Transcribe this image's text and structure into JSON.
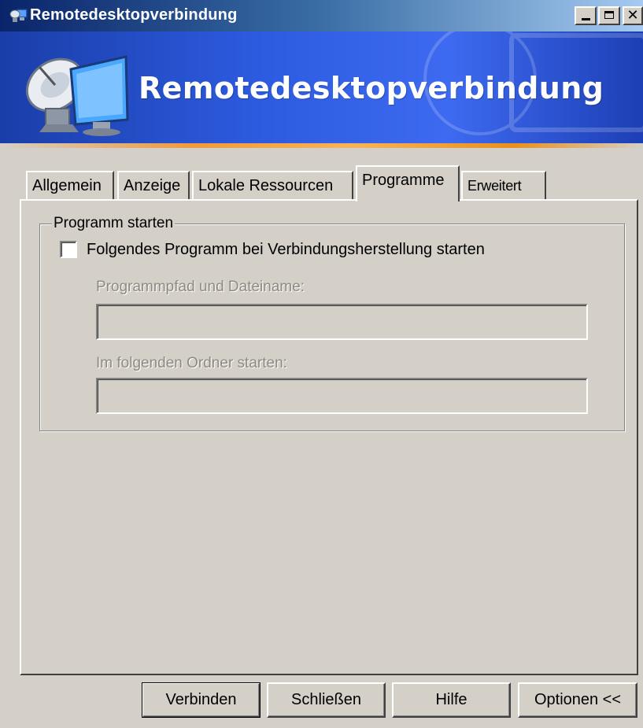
{
  "window": {
    "title": "Remotedesktopverbindung",
    "icon": "remote-desktop-icon",
    "controls": [
      "minimize-icon",
      "maximize-icon",
      "close-icon"
    ]
  },
  "banner": {
    "title": "Remotedesktopverbindung",
    "icon": "remote-desktop-satellite-monitor-icon"
  },
  "tabs": [
    {
      "label": "Allgemein",
      "active": false
    },
    {
      "label": "Anzeige",
      "active": false
    },
    {
      "label": "Lokale Ressourcen",
      "active": false
    },
    {
      "label": "Programme",
      "active": true
    },
    {
      "label": "Erweitert",
      "active": false
    }
  ],
  "group": {
    "legend": "Programm starten",
    "checkbox_label": "Folgendes Programm bei Verbindungsherstellung starten",
    "checkbox_checked": false,
    "path_label": "Programmpfad und Dateiname:",
    "path_value": "",
    "folder_label": "Im folgenden Ordner starten:",
    "folder_value": ""
  },
  "buttons": {
    "connect": "Verbinden",
    "close": "Schließen",
    "help": "Hilfe",
    "options": "Optionen <<"
  },
  "colors": {
    "face": "#d4d0c8",
    "title_start": "#0a246a",
    "title_end": "#a6caf0",
    "banner": "#2d5be0",
    "accent_strip": "#f09a3c",
    "disabled_text": "#8e8a82"
  }
}
